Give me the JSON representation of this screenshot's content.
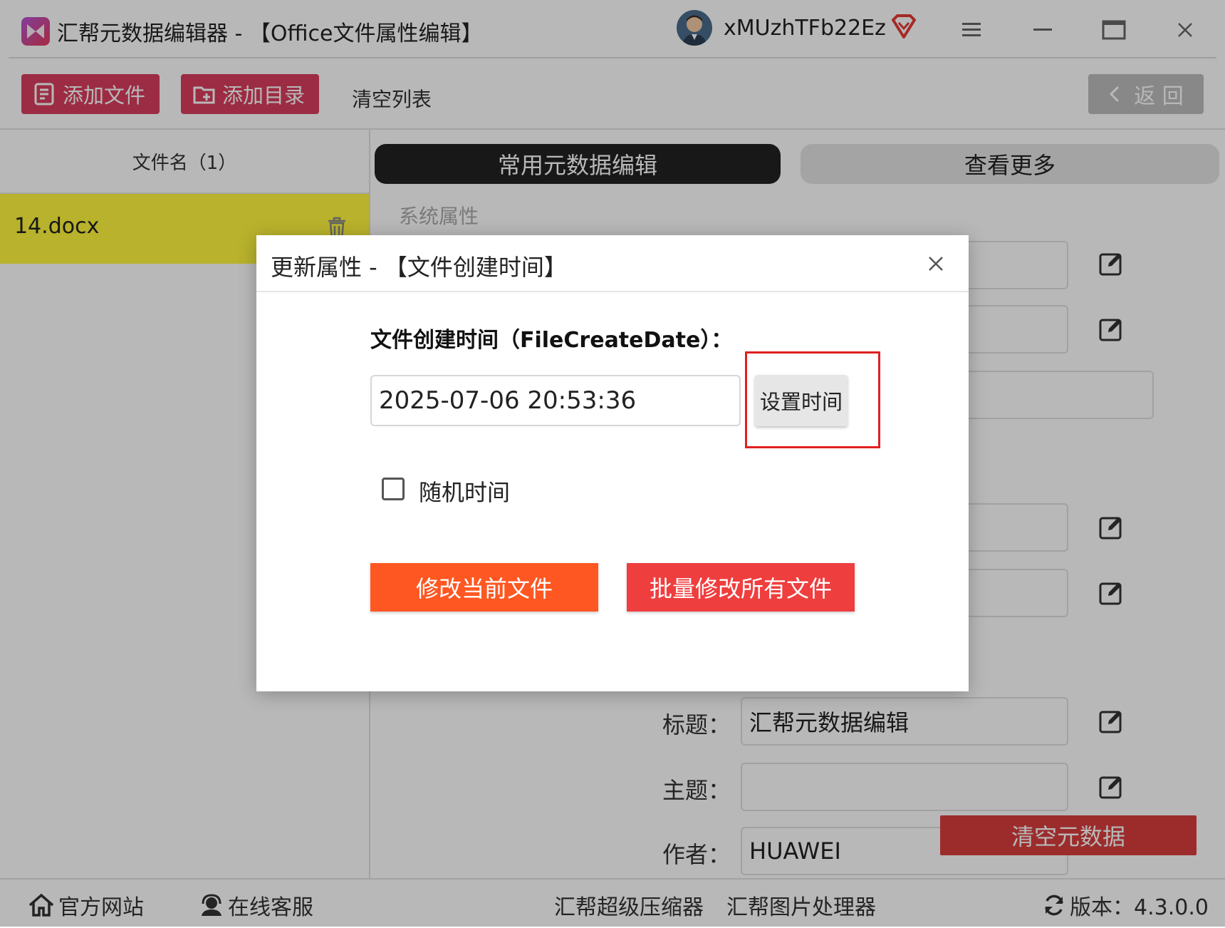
{
  "window": {
    "title": "汇帮元数据编辑器 - 【Office文件属性编辑】",
    "username": "xMUzhTFb22Ez"
  },
  "toolbar": {
    "add_file": "添加文件",
    "add_dir": "添加目录",
    "clear_list": "清空列表",
    "back": "返 回"
  },
  "file_list": {
    "header": "文件名（1）",
    "items": [
      {
        "name": "14.docx"
      }
    ]
  },
  "tabs": {
    "common": "常用元数据编辑",
    "more": "查看更多"
  },
  "properties": {
    "section_system": "系统属性",
    "title_label": "标题：",
    "title_value": "汇帮元数据编辑",
    "subject_label": "主题：",
    "subject_value": "",
    "author_label": "作者：",
    "author_value": "HUAWEI",
    "clear_metadata": "清空元数据"
  },
  "dialog": {
    "title": "更新属性 - 【文件创建时间】",
    "field_label": "文件创建时间（FileCreateDate）：",
    "date_value": "2025-07-06 20:53:36",
    "set_time": "设置时间",
    "random_time": "随机时间",
    "random_checked": false,
    "modify_current": "修改当前文件",
    "batch_modify": "批量修改所有文件"
  },
  "footer": {
    "website": "官方网站",
    "support": "在线客服",
    "compressor": "汇帮超级压缩器",
    "image_processor": "汇帮图片处理器",
    "version": "版本：4.3.0.0"
  },
  "colors": {
    "accent_pink": "#d83d5e",
    "selected_row": "#fff73e",
    "modify_orange": "#ff5722",
    "batch_red": "#ef3e3e",
    "highlight_red": "#e02020"
  }
}
